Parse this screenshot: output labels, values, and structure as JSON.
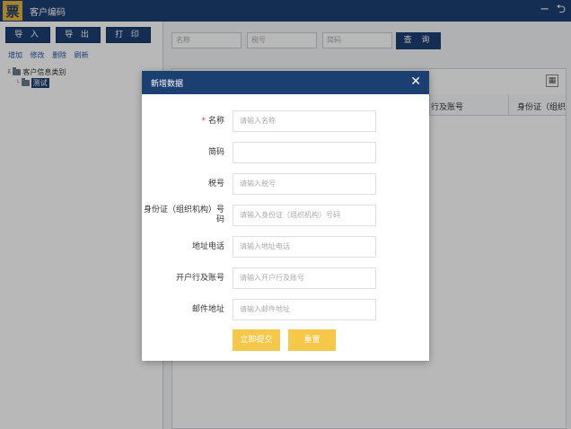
{
  "app": {
    "logo_char": "票",
    "title": "客户编码",
    "minimize_glyph": "−",
    "back_glyph": "⮌"
  },
  "toolbar": {
    "import_label": "导 入",
    "export_label": "导 出",
    "print_label": "打 印"
  },
  "actions": {
    "add": "增加",
    "edit": "修改",
    "delete": "删除",
    "refresh": "刷新"
  },
  "tree": {
    "root": "客户信息类别",
    "child": "测试"
  },
  "search": {
    "name_placeholder": "名称",
    "tax_placeholder": "税号",
    "short_placeholder": "简码",
    "query_label": "查 询"
  },
  "grid": {
    "columns": [
      "行及账号",
      "身份证（组织"
    ],
    "settings_icon": "grid-settings-icon"
  },
  "modal": {
    "title": "新增数据",
    "close_glyph": "✕",
    "fields": [
      {
        "label": "名称",
        "required": true,
        "placeholder": "请输入名称",
        "value": ""
      },
      {
        "label": "简码",
        "required": false,
        "placeholder": "",
        "value": ""
      },
      {
        "label": "税号",
        "required": false,
        "placeholder": "请输入税号",
        "value": ""
      },
      {
        "label": "身份证（组织机构）号码",
        "required": false,
        "placeholder": "请输入身份证（组织机构）号码",
        "value": ""
      },
      {
        "label": "地址电话",
        "required": false,
        "placeholder": "请输入地址电话",
        "value": ""
      },
      {
        "label": "开户行及账号",
        "required": false,
        "placeholder": "请输入开户行及账号",
        "value": ""
      },
      {
        "label": "邮件地址",
        "required": false,
        "placeholder": "请输入邮件地址",
        "value": ""
      }
    ],
    "submit_label": "立即提交",
    "reset_label": "重置",
    "required_mark": "*"
  },
  "colors": {
    "primary": "#1c3f72",
    "accent_button": "#f6c84a",
    "required": "#e03b2e"
  }
}
